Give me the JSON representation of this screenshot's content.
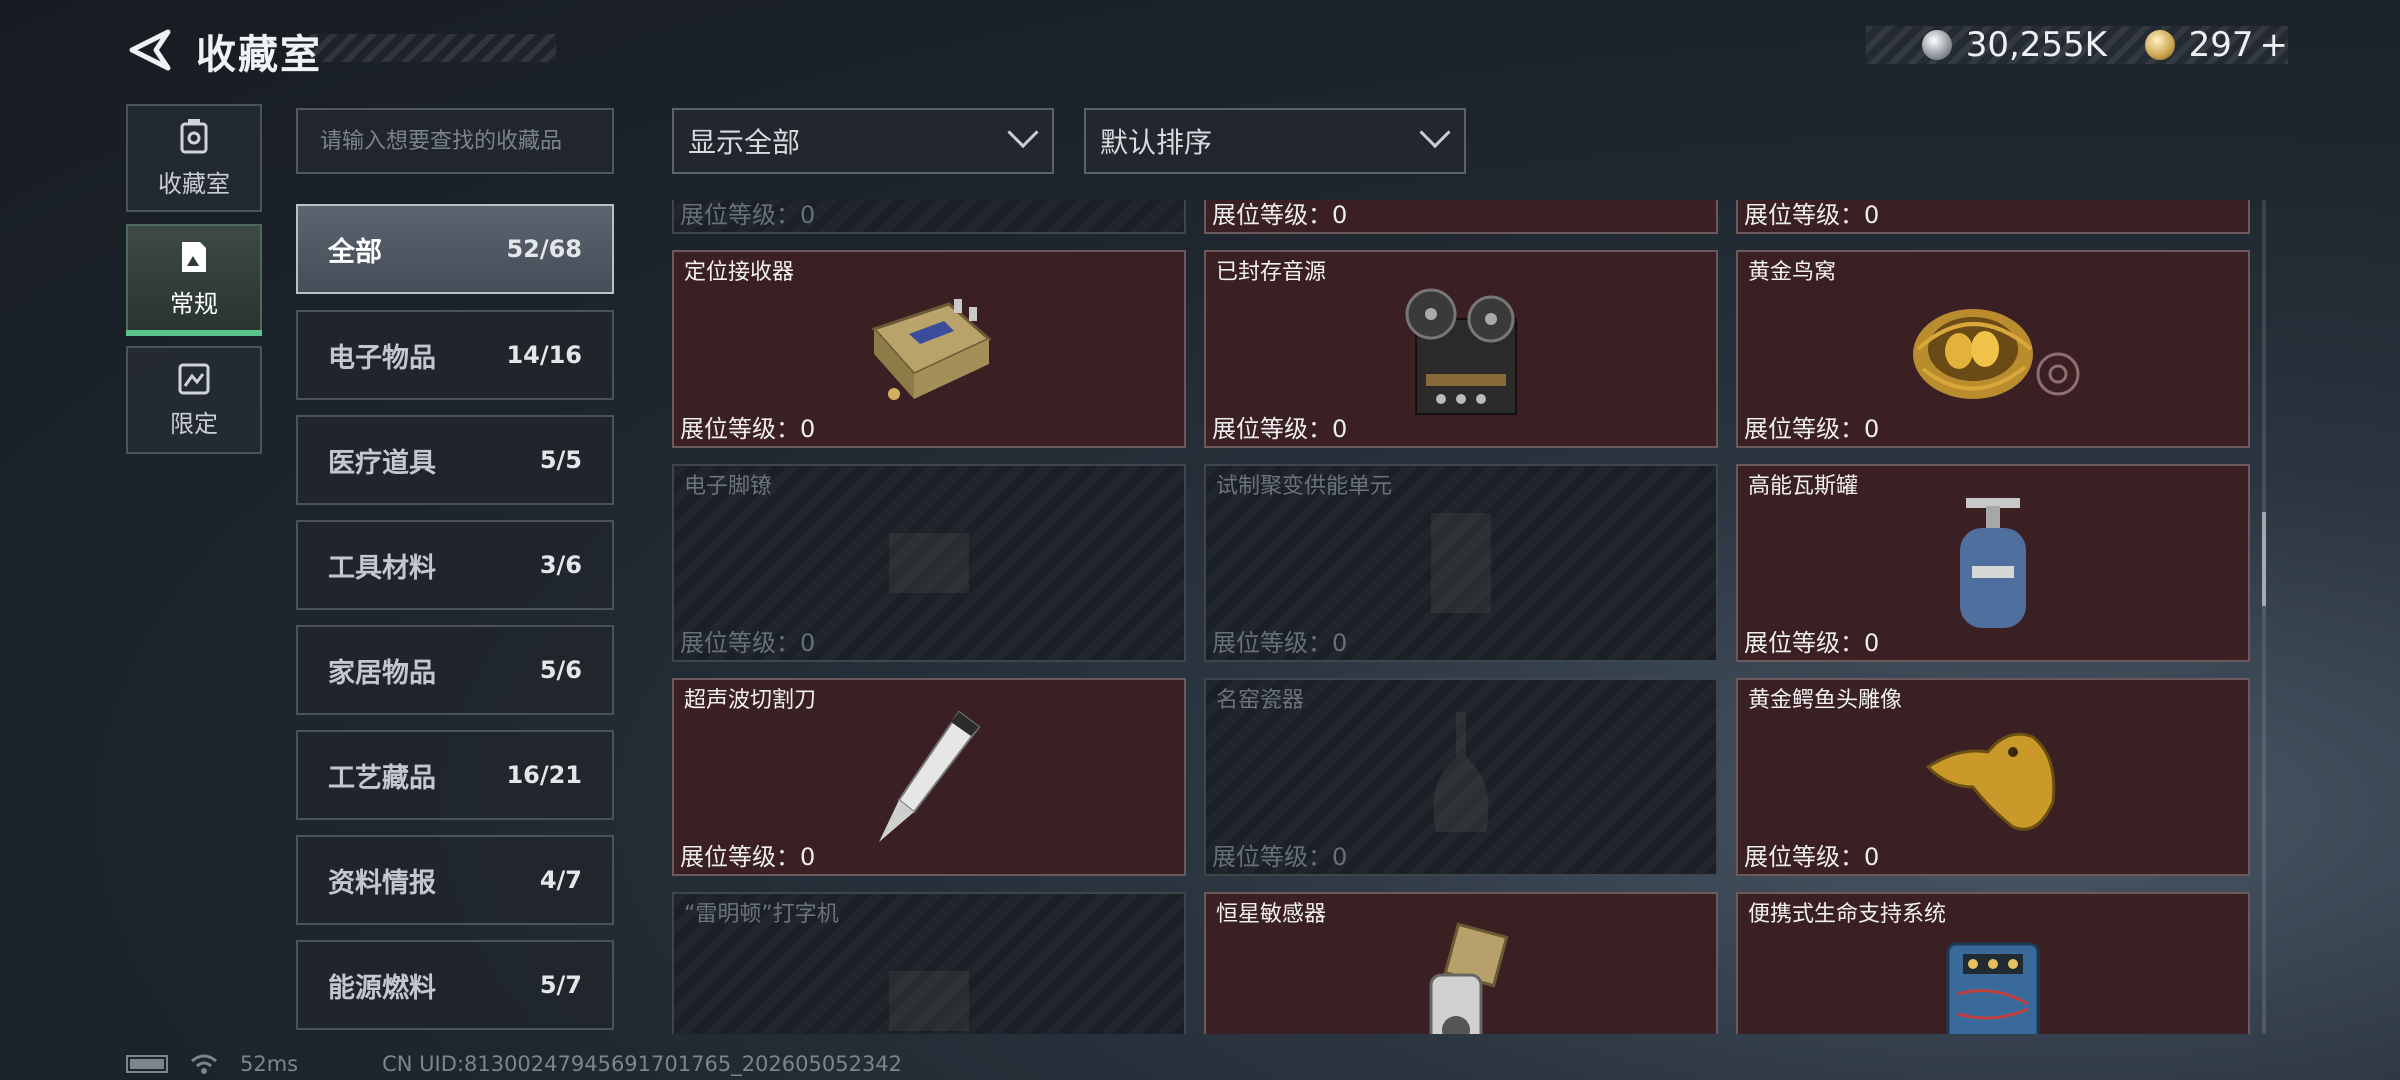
{
  "header": {
    "title": "收藏室",
    "currency_silver": "30,255K",
    "currency_gold": "297",
    "add_symbol": "+"
  },
  "nav": [
    {
      "label": "收藏室",
      "icon": "collection-icon"
    },
    {
      "label": "常规",
      "icon": "regular-icon",
      "active": true
    },
    {
      "label": "限定",
      "icon": "limited-icon"
    }
  ],
  "search": {
    "placeholder": "请输入想要查找的收藏品"
  },
  "categories": [
    {
      "label": "全部",
      "count": "52/68",
      "active": true
    },
    {
      "label": "电子物品",
      "count": "14/16"
    },
    {
      "label": "医疗道具",
      "count": "5/5"
    },
    {
      "label": "工具材料",
      "count": "3/6"
    },
    {
      "label": "家居物品",
      "count": "5/6"
    },
    {
      "label": "工艺藏品",
      "count": "16/21"
    },
    {
      "label": "资料情报",
      "count": "4/7"
    },
    {
      "label": "能源燃料",
      "count": "5/7"
    }
  ],
  "filters": {
    "display": "显示全部",
    "sort": "默认排序"
  },
  "level_label": "展位等级：0",
  "items": [
    {
      "name": "",
      "owned": false
    },
    {
      "name": "",
      "owned": true
    },
    {
      "name": "",
      "owned": true
    },
    {
      "name": "定位接收器",
      "owned": true,
      "icon": "receiver-icon"
    },
    {
      "name": "已封存音源",
      "owned": true,
      "icon": "tape-recorder-icon"
    },
    {
      "name": "黄金鸟窝",
      "owned": true,
      "icon": "golden-nest-icon"
    },
    {
      "name": "电子脚镣",
      "owned": false,
      "icon": "ankle-monitor-icon"
    },
    {
      "name": "试制聚变供能单元",
      "owned": false,
      "icon": "fusion-unit-icon"
    },
    {
      "name": "高能瓦斯罐",
      "owned": true,
      "icon": "gas-tank-icon"
    },
    {
      "name": "超声波切割刀",
      "owned": true,
      "icon": "ultrasonic-cutter-icon"
    },
    {
      "name": "名窑瓷器",
      "owned": false,
      "icon": "porcelain-vase-icon"
    },
    {
      "name": "黄金鳄鱼头雕像",
      "owned": true,
      "icon": "gold-crocodile-icon"
    },
    {
      "name": "“雷明顿”打字机",
      "owned": false,
      "icon": "typewriter-icon"
    },
    {
      "name": "恒星敏感器",
      "owned": true,
      "icon": "star-sensor-icon"
    },
    {
      "name": "便携式生命支持系统",
      "owned": true,
      "icon": "life-support-icon"
    }
  ],
  "footer": {
    "ping": "52ms",
    "uid": "CN UID:8130024794569170​1765_202605052342"
  }
}
